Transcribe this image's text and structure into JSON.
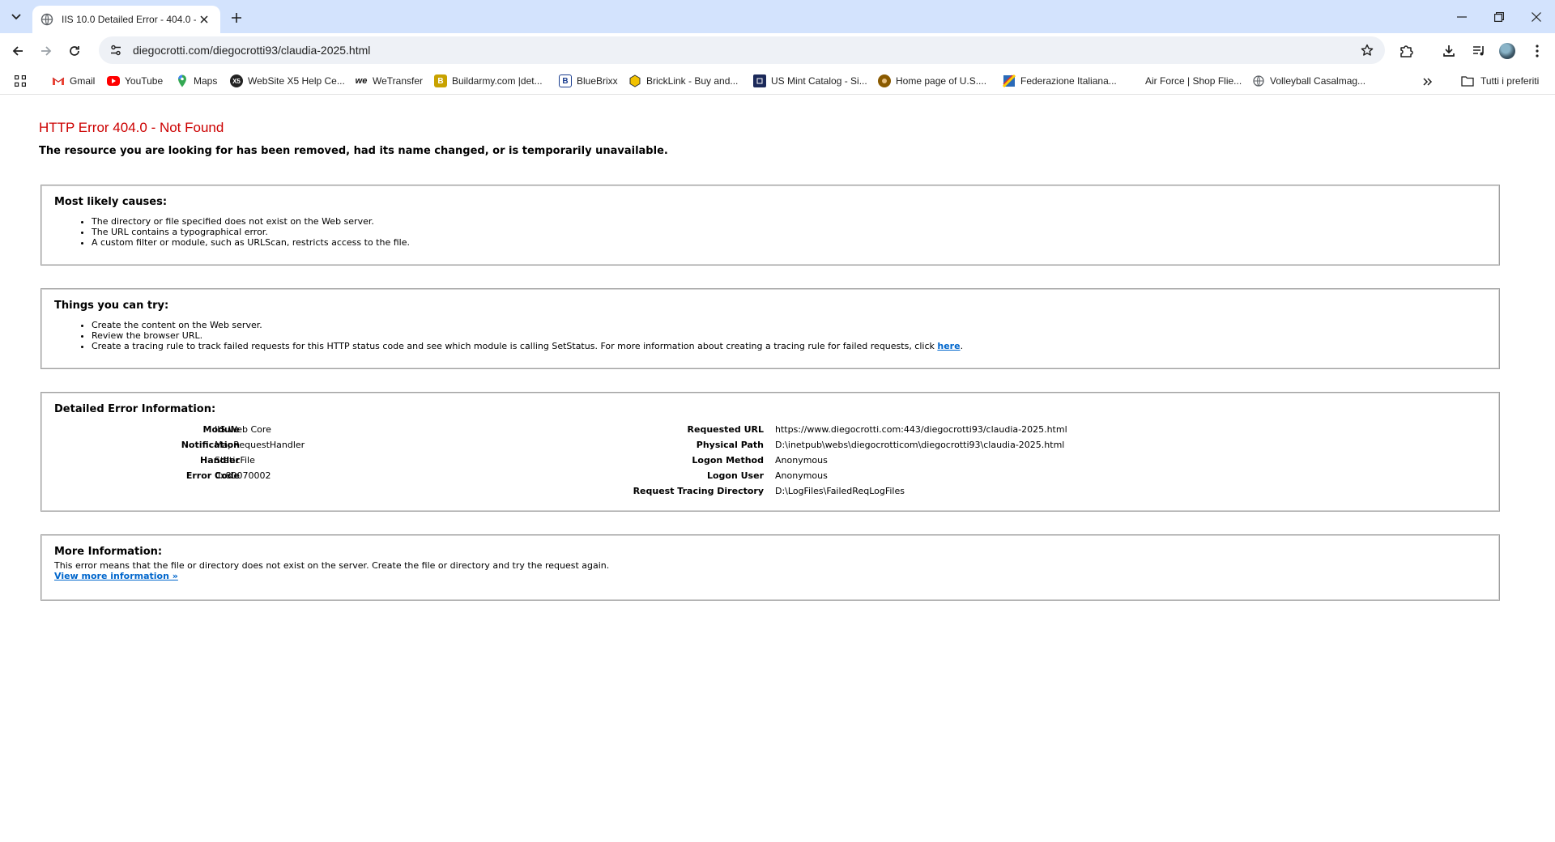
{
  "browser": {
    "tab_title": "IIS 10.0 Detailed Error - 404.0 -",
    "url": "diegocrotti.com/diegocrotti93/claudia-2025.html",
    "bookmarks": [
      {
        "label": "Gmail",
        "icon": "gmail-icon",
        "color": "#ea4335"
      },
      {
        "label": "YouTube",
        "icon": "youtube-icon",
        "color": "#ff0000"
      },
      {
        "label": "Maps",
        "icon": "maps-icon",
        "color": "#34a853"
      },
      {
        "label": "WebSite X5 Help Ce...",
        "icon": "websitex5-icon",
        "color": "#222222"
      },
      {
        "label": "WeTransfer",
        "icon": "wetransfer-icon",
        "color": "#111111"
      },
      {
        "label": "Buildarmy.com |det...",
        "icon": "buildarmy-icon",
        "color": "#c8a200"
      },
      {
        "label": "BlueBrixx",
        "icon": "bluebrixx-icon",
        "color": "#1a3d8f"
      },
      {
        "label": "BrickLink - Buy and...",
        "icon": "bricklink-icon",
        "color": "#f2c200"
      },
      {
        "label": "US Mint Catalog - Si...",
        "icon": "usmint-icon",
        "color": "#1c2a5a"
      },
      {
        "label": "Home page of U.S....",
        "icon": "us-home-icon",
        "color": "#8a5a00"
      },
      {
        "label": "Federazione Italiana...",
        "icon": "federazione-icon",
        "color": "#2a6ab8"
      },
      {
        "label": "Air Force | Shop Flie...",
        "icon": "airforce-icon",
        "color": "#ffffff"
      },
      {
        "label": "Volleyball Casalmag...",
        "icon": "globe-icon",
        "color": "#5f6368"
      }
    ],
    "all_bookmarks": "Tutti i preferiti"
  },
  "page": {
    "title": "HTTP Error 404.0 - Not Found",
    "subtitle": "The resource you are looking for has been removed, had its name changed, or is temporarily unavailable.",
    "causes": {
      "heading": "Most likely causes:",
      "items": [
        "The directory or file specified does not exist on the Web server.",
        "The URL contains a typographical error.",
        "A custom filter or module, such as URLScan, restricts access to the file."
      ]
    },
    "try": {
      "heading": "Things you can try:",
      "items": [
        "Create the content on the Web server.",
        "Review the browser URL."
      ],
      "item3_text": "Create a tracing rule to track failed requests for this HTTP status code and see which module is calling SetStatus. For more information about creating a tracing rule for failed requests, click ",
      "item3_link": "here",
      "item3_end": "."
    },
    "details": {
      "heading": "Detailed Error Information:",
      "left": [
        {
          "label": "Module",
          "value": "IIS Web Core"
        },
        {
          "label": "Notification",
          "value": "MapRequestHandler"
        },
        {
          "label": "Handler",
          "value": "StaticFile"
        },
        {
          "label": "Error Code",
          "value": "0x80070002"
        }
      ],
      "right": [
        {
          "label": "Requested URL",
          "value": "https://www.diegocrotti.com:443/diegocrotti93/claudia-2025.html"
        },
        {
          "label": "Physical Path",
          "value": "D:\\inetpub\\webs\\diegocrotticom\\diegocrotti93\\claudia-2025.html"
        },
        {
          "label": "Logon Method",
          "value": "Anonymous"
        },
        {
          "label": "Logon User",
          "value": "Anonymous"
        },
        {
          "label": "Request Tracing Directory",
          "value": "D:\\LogFiles\\FailedReqLogFiles"
        }
      ]
    },
    "more": {
      "heading": "More Information:",
      "text": "This error means that the file or directory does not exist on the server. Create the file or directory and try the request again.",
      "link": "View more information »"
    }
  }
}
